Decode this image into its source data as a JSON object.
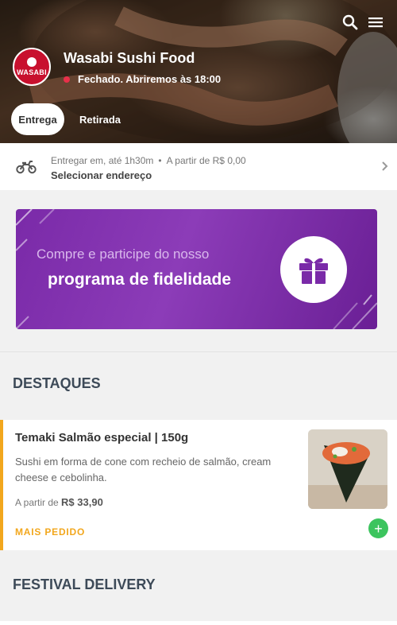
{
  "header": {
    "store_name": "Wasabi Sushi Food",
    "status": "Fechado. Abriremos às 18:00",
    "logo_text": "WASABI",
    "icons": {
      "search": "search-icon",
      "menu": "menu-icon"
    },
    "tabs": [
      {
        "label": "Entrega",
        "selected": true
      },
      {
        "label": "Retirada",
        "selected": false
      }
    ]
  },
  "delivery": {
    "eta": "Entregar em, até 1h30m",
    "min_price": "A partir de R$ 0,00",
    "address": "Selecionar endereço",
    "icon": "motorcycle-icon"
  },
  "promo": {
    "line1": "Compre e participe do nosso",
    "line2": "programa de fidelidade",
    "icon": "gift-icon"
  },
  "sections": {
    "highlights": "DESTAQUES",
    "festival": "FESTIVAL DELIVERY"
  },
  "featured_item": {
    "name": "Temaki Salmão especial | 150g",
    "description": "Sushi em forma de cone com recheio de salmão, cream cheese e cebolinha.",
    "price_prefix": "A partir de",
    "price": "R$ 33,90",
    "badge": "MAIS PEDIDO",
    "add_label": "+"
  },
  "colors": {
    "accent": "#f2a71d",
    "closed_status": "#e8304a",
    "add_button": "#3cc45e",
    "promo_purple": "#8c3cb8",
    "logo_red": "#c8102e"
  }
}
